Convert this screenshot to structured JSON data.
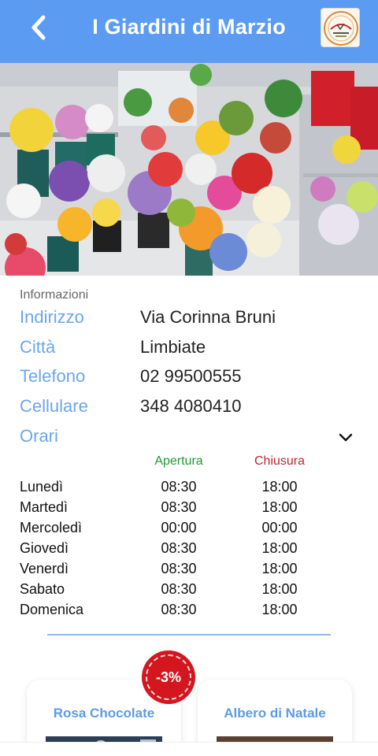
{
  "header": {
    "title": "I Giardini di Marzio",
    "back_icon": "chevron-left-icon",
    "logo_icon": "shop-logo"
  },
  "hero": {
    "image": "flower-shop-photo"
  },
  "info": {
    "section_label": "Informazioni",
    "rows": [
      {
        "key": "Indirizzo",
        "value": "Via Corinna Bruni"
      },
      {
        "key": "Città",
        "value": "Limbiate"
      },
      {
        "key": "Telefono",
        "value": "02 99500555"
      },
      {
        "key": "Cellulare",
        "value": "348 4080410"
      }
    ],
    "hours_label": "Orari",
    "hours_toggle_icon": "chevron-down-icon"
  },
  "hours": {
    "open_header": "Apertura",
    "close_header": "Chiusura",
    "days": [
      {
        "day": "Lunedì",
        "open": "08:30",
        "close": "18:00"
      },
      {
        "day": "Martedì",
        "open": "08:30",
        "close": "18:00"
      },
      {
        "day": "Mercoledì",
        "open": "00:00",
        "close": "00:00"
      },
      {
        "day": "Giovedì",
        "open": "08:30",
        "close": "18:00"
      },
      {
        "day": "Venerdì",
        "open": "08:30",
        "close": "18:00"
      },
      {
        "day": "Sabato",
        "open": "08:30",
        "close": "18:00"
      },
      {
        "day": "Domenica",
        "open": "08:30",
        "close": "18:00"
      }
    ]
  },
  "products": [
    {
      "title": "Rosa Chocolate",
      "badge": "-3%"
    },
    {
      "title": "Albero di Natale"
    }
  ],
  "colors": {
    "appbar": "#5b9cf2",
    "info_key": "#6aa6ee",
    "open_header": "#1f9a2d",
    "close_header": "#c0272d",
    "badge": "#d4161f"
  }
}
